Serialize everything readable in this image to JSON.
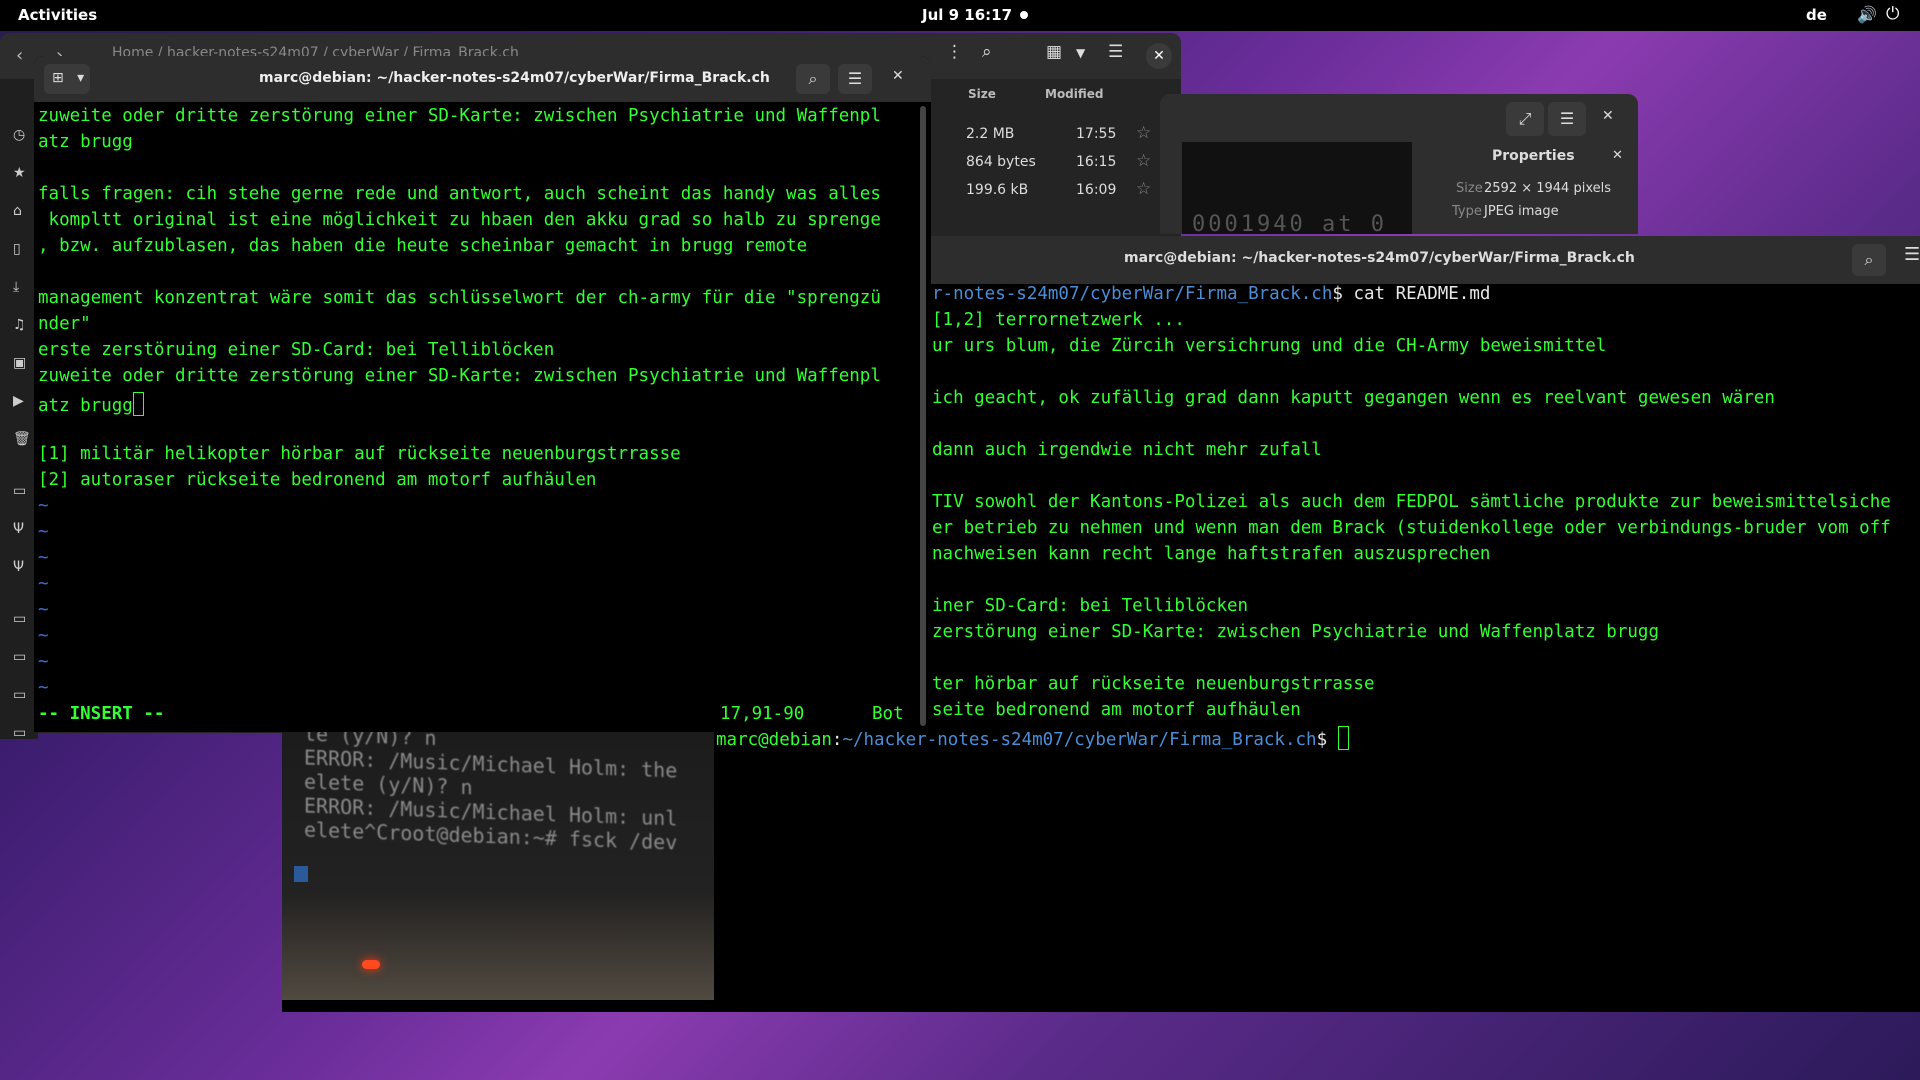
{
  "topbar": {
    "activities": "Activities",
    "clock": "Jul 9  16:17",
    "lang": "de",
    "volume_icon": "volume-icon",
    "power_icon": "power-icon"
  },
  "files": {
    "breadcrumbs": "Home  /  hacker-notes-s24m07  /  cyberWar  /  Firma_Brack.ch",
    "columns": {
      "size": "Size",
      "modified": "Modified"
    },
    "rows": [
      {
        "size": "2.2 MB",
        "modified": "17:55"
      },
      {
        "size": "864 bytes",
        "modified": "16:15"
      },
      {
        "size": "199.6 kB",
        "modified": "16:09"
      }
    ]
  },
  "viewer": {
    "ghost_text": "0001940 at 0",
    "properties_title": "Properties",
    "size_label": "Size",
    "size_value": "2592 × 1944 pixels",
    "type_label": "Type",
    "type_value": "JPEG image"
  },
  "photo": {
    "text": "te (y/N)? n\nERROR: /Music/Michael Holm: the\nelete (y/N)? n\nERROR: /Music/Michael Holm: unl\nelete^Croot@debian:~# fsck /dev"
  },
  "term_right": {
    "title": "marc@debian: ~/hacker-notes-s24m07/cyberWar/Firma_Brack.ch",
    "prompt_path_partial": "r-notes-s24m07/cyberWar/Firma_Brack.ch",
    "command": "$ cat README.md",
    "lines": [
      "[1,2] terrornetzwerk ...",
      "ur urs blum, die Zürcih versichrung und die CH-Army beweismittel",
      "",
      "ich geacht, ok zufällig grad dann kaputt gegangen wenn es reelvant gewesen wären",
      "",
      "dann auch irgendwie nicht mehr zufall",
      "",
      "TIV sowohl der Kantons-Polizei als auch dem FEDPOL sämtliche produkte zur beweismittelsiche",
      "er betrieb zu nehmen und wenn man dem Brack (stuidenkollege oder verbindungs-bruder vom off",
      "nachweisen kann recht lange haftstrafen auszusprechen",
      "",
      "iner SD-Card: bei Telliblöcken",
      "zerstörung einer SD-Karte: zwischen Psychiatrie und Waffenplatz brugg",
      "",
      "ter hörbar auf rückseite neuenburgstrrasse",
      "seite bedronend am motorf aufhäulen"
    ],
    "prompt_user": "marc@debian",
    "prompt_path": "~/hacker-notes-s24m07/cyberWar/Firma_Brack.ch",
    "prompt_end": "$ "
  },
  "term_left": {
    "title": "marc@debian: ~/hacker-notes-s24m07/cyberWar/Firma_Brack.ch",
    "lines": [
      "zuweite oder dritte zerstörung einer SD-Karte: zwischen Psychiatrie und Waffenpl",
      "atz brugg",
      "",
      "falls fragen: cih stehe gerne rede und antwort, auch scheint das handy was alles",
      " kompltt original ist eine möglichkeit zu hbaen den akku grad so halb zu sprenge",
      ", bzw. aufzublasen, das haben die heute scheinbar gemacht in brugg remote",
      "",
      "management konzentrat wäre somit das schlüsselwort der ch-army für die \"sprengzü",
      "nder\"",
      "erste zerstöruing einer SD-Card: bei Telliblöcken",
      "zuweite oder dritte zerstörung einer SD-Karte: zwischen Psychiatrie und Waffenpl"
    ],
    "cursor_line": "atz brugg",
    "footnotes": [
      "[1] militär helikopter hörbar auf rückseite neuenburgstrrasse",
      "[2] autoraser rückseite bedronend am motorf aufhäulen"
    ],
    "tildes": [
      "~",
      "~",
      "~",
      "~",
      "~",
      "~",
      "~",
      "~"
    ],
    "mode": "-- INSERT --",
    "position": "17,91-90",
    "scroll": "Bot"
  }
}
